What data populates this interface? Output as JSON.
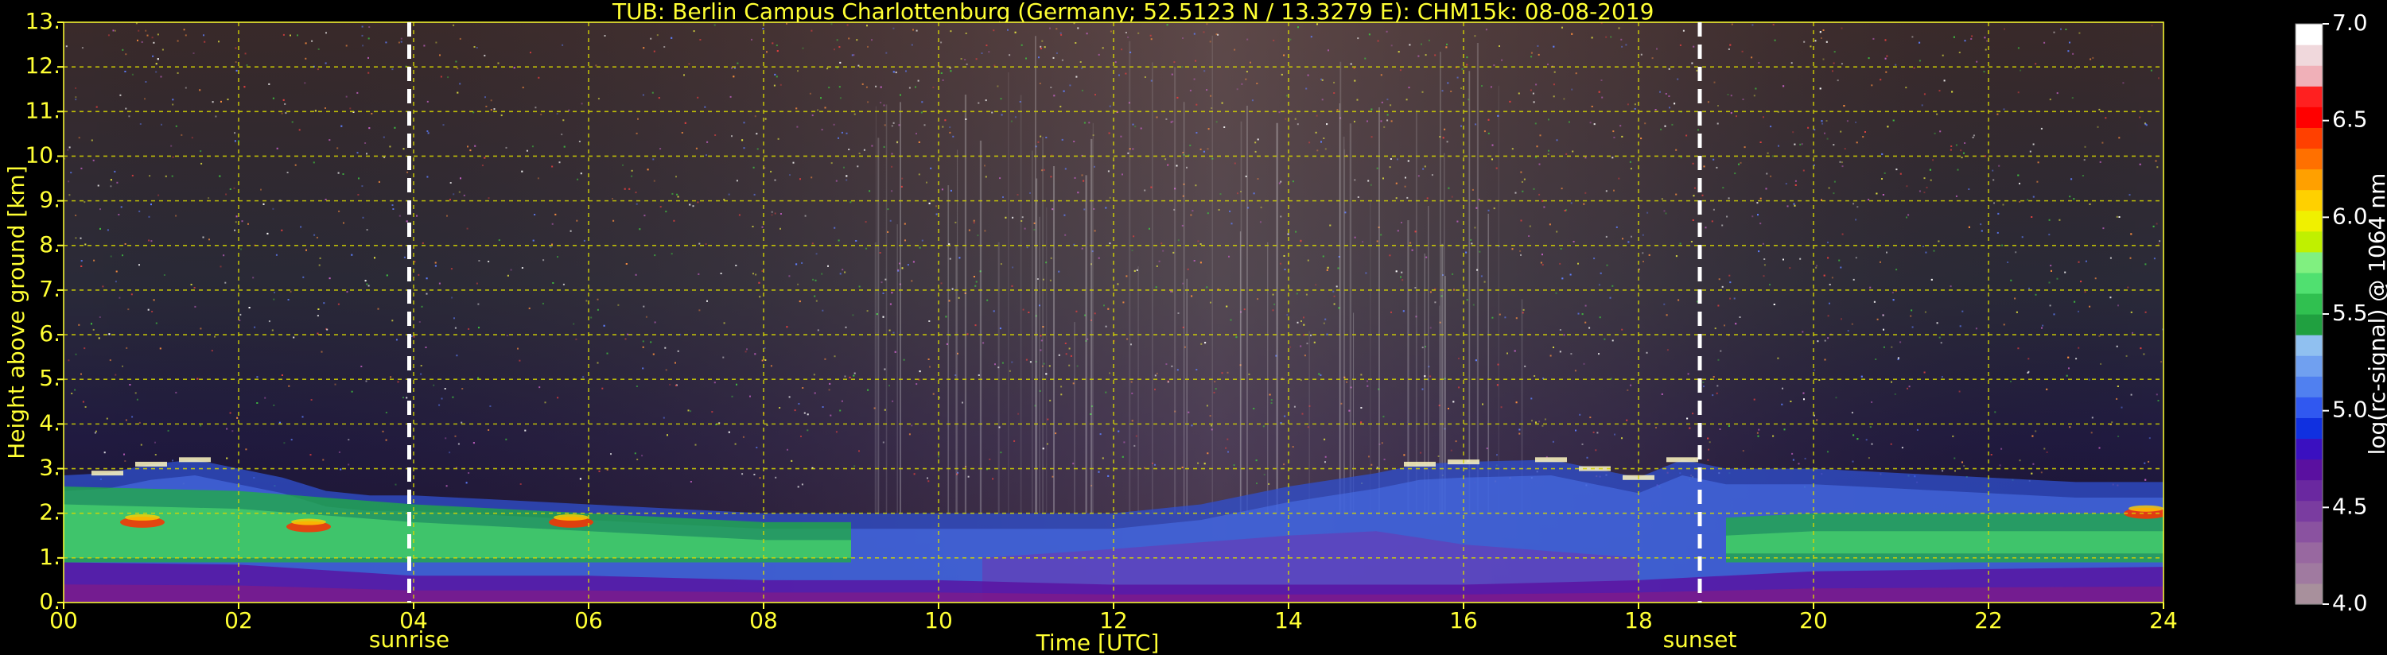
{
  "chart_data": {
    "type": "heatmap",
    "title": "TUB: Berlin Campus Charlottenburg (Germany; 52.5123 N / 13.3279 E):    CHM15k: 08-08-2019",
    "xlabel": "Time [UTC]",
    "ylabel": "Height above ground [km]",
    "x_ticks": [
      "00",
      "02",
      "04",
      "06",
      "08",
      "10",
      "12",
      "14",
      "16",
      "18",
      "20",
      "22",
      "24"
    ],
    "y_ticks": [
      "0.",
      "1.",
      "2.",
      "3.",
      "4.",
      "5.",
      "6.",
      "7.",
      "8.",
      "9.",
      "10.",
      "11.",
      "12.",
      "13."
    ],
    "xlim": [
      0,
      24
    ],
    "ylim": [
      0,
      13
    ],
    "grid": true,
    "markers": [
      {
        "label": "sunrise",
        "x": 3.95
      },
      {
        "label": "sunset",
        "x": 18.7
      }
    ],
    "colorbar": {
      "label": "log(rc-signal) @ 1064 nm",
      "range": [
        4.0,
        7.0
      ],
      "ticks": [
        "4.0",
        "4.5",
        "5.0",
        "5.5",
        "6.0",
        "6.5",
        "7.0"
      ],
      "colors": [
        "#a8909c",
        "#a07aa0",
        "#9868a0",
        "#8a52a0",
        "#7a3ca0",
        "#6a28a0",
        "#5a10a0",
        "#3a10c0",
        "#1030e0",
        "#3058f0",
        "#5080f0",
        "#70a0f0",
        "#90c0f0",
        "#20a040",
        "#30c050",
        "#50e070",
        "#80f080",
        "#c0f000",
        "#f0f000",
        "#ffd000",
        "#ffa000",
        "#ff7000",
        "#ff4000",
        "#ff0000",
        "#ff2020",
        "#f0b0b8",
        "#f0d8dc",
        "#ffffff"
      ]
    },
    "boundary_layer_top_km": [
      [
        0,
        2.85
      ],
      [
        0.5,
        2.9
      ],
      [
        1,
        3.1
      ],
      [
        1.5,
        3.2
      ],
      [
        2,
        3.0
      ],
      [
        2.5,
        2.8
      ],
      [
        3,
        2.5
      ],
      [
        3.5,
        2.4
      ],
      [
        4,
        2.4
      ],
      [
        5,
        2.3
      ],
      [
        6,
        2.2
      ],
      [
        7,
        2.1
      ],
      [
        8,
        2.0
      ],
      [
        9,
        2.0
      ],
      [
        10,
        2.0
      ],
      [
        11,
        2.0
      ],
      [
        12,
        2.0
      ],
      [
        13,
        2.2
      ],
      [
        14,
        2.6
      ],
      [
        15,
        2.9
      ],
      [
        15.5,
        3.1
      ],
      [
        16,
        3.15
      ],
      [
        17,
        3.2
      ],
      [
        17.5,
        3.0
      ],
      [
        18,
        2.8
      ],
      [
        18.5,
        3.2
      ],
      [
        19,
        3.0
      ],
      [
        20,
        3.0
      ],
      [
        21,
        2.9
      ],
      [
        22,
        2.8
      ],
      [
        23,
        2.7
      ],
      [
        24,
        2.7
      ]
    ],
    "residual_layer_top_km": [
      [
        0,
        2.6
      ],
      [
        2,
        2.5
      ],
      [
        4,
        2.2
      ],
      [
        6,
        2.0
      ],
      [
        8,
        1.8
      ],
      [
        9,
        1.8
      ],
      [
        19,
        1.9
      ],
      [
        20,
        2.0
      ],
      [
        22,
        2.0
      ],
      [
        24,
        2.0
      ]
    ],
    "surface_layer_top_km": [
      [
        0,
        0.9
      ],
      [
        2,
        0.85
      ],
      [
        4,
        0.6
      ],
      [
        6,
        0.6
      ],
      [
        8,
        0.5
      ],
      [
        10,
        0.5
      ],
      [
        12,
        0.4
      ],
      [
        14,
        0.4
      ],
      [
        16,
        0.4
      ],
      [
        18,
        0.5
      ],
      [
        20,
        0.7
      ],
      [
        22,
        0.75
      ],
      [
        24,
        0.8
      ]
    ]
  }
}
